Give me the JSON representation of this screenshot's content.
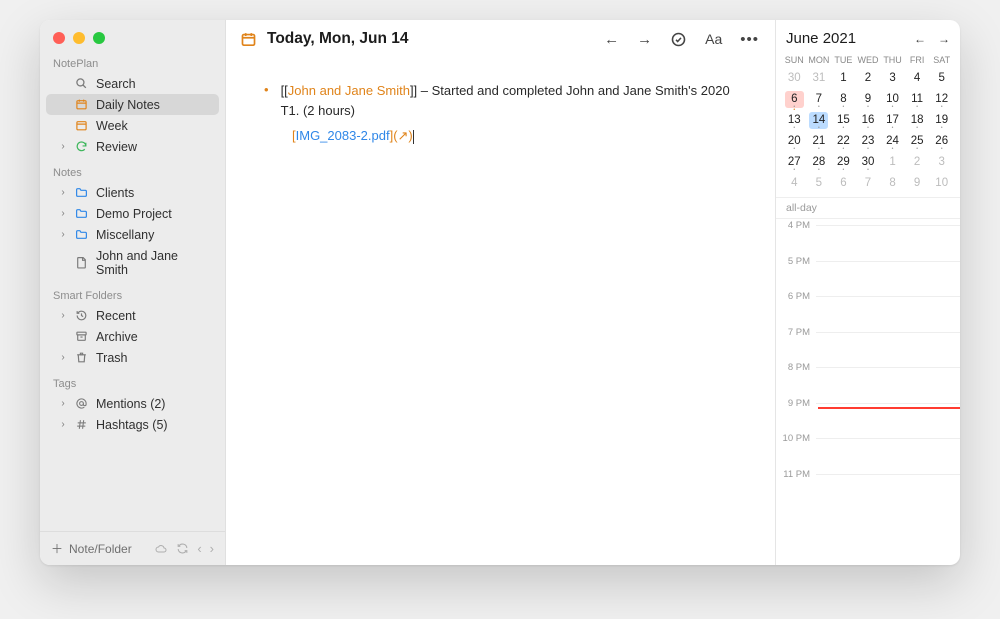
{
  "app": {
    "name": "NotePlan"
  },
  "sidebar": {
    "sections": {
      "main": {
        "search": "Search",
        "daily": "Daily Notes",
        "week": "Week",
        "review": "Review"
      },
      "notes_title": "Notes",
      "notes": {
        "clients": "Clients",
        "demo": "Demo Project",
        "misc": "Miscellany",
        "jj": "John and Jane Smith"
      },
      "smart_title": "Smart Folders",
      "smart": {
        "recent": "Recent",
        "archive": "Archive",
        "trash": "Trash"
      },
      "tags_title": "Tags",
      "tags": {
        "mentions": "Mentions (2)",
        "hashtags": "Hashtags (5)"
      }
    },
    "footer": {
      "add": "Note/Folder"
    }
  },
  "editor": {
    "title": "Today, Mon, Jun 14",
    "bullet": {
      "open": "[[",
      "link": "John and Jane Smith",
      "close": "]]",
      "rest": " – Started and completed John and Jane Smith's 2020 T1. (2 hours)"
    },
    "attach": {
      "open": "[",
      "file": "IMG_2083-2.pdf",
      "close": "](↗)"
    }
  },
  "calendar": {
    "month": "June 2021",
    "day_labels": [
      "SUN",
      "MON",
      "TUE",
      "WED",
      "THU",
      "FRI",
      "SAT"
    ],
    "weeks": [
      [
        "30",
        "31",
        "1",
        "2",
        "3",
        "4",
        "5"
      ],
      [
        "6",
        "7",
        "8",
        "9",
        "10",
        "11",
        "12"
      ],
      [
        "13",
        "14",
        "15",
        "16",
        "17",
        "18",
        "19"
      ],
      [
        "20",
        "21",
        "22",
        "23",
        "24",
        "25",
        "26"
      ],
      [
        "27",
        "28",
        "29",
        "30",
        "1",
        "2",
        "3"
      ],
      [
        "4",
        "5",
        "6",
        "7",
        "8",
        "9",
        "10"
      ]
    ],
    "allday": "all-day",
    "hours": [
      "4 PM",
      "5 PM",
      "6 PM",
      "7 PM",
      "8 PM",
      "9 PM",
      "10 PM",
      "11 PM"
    ]
  }
}
